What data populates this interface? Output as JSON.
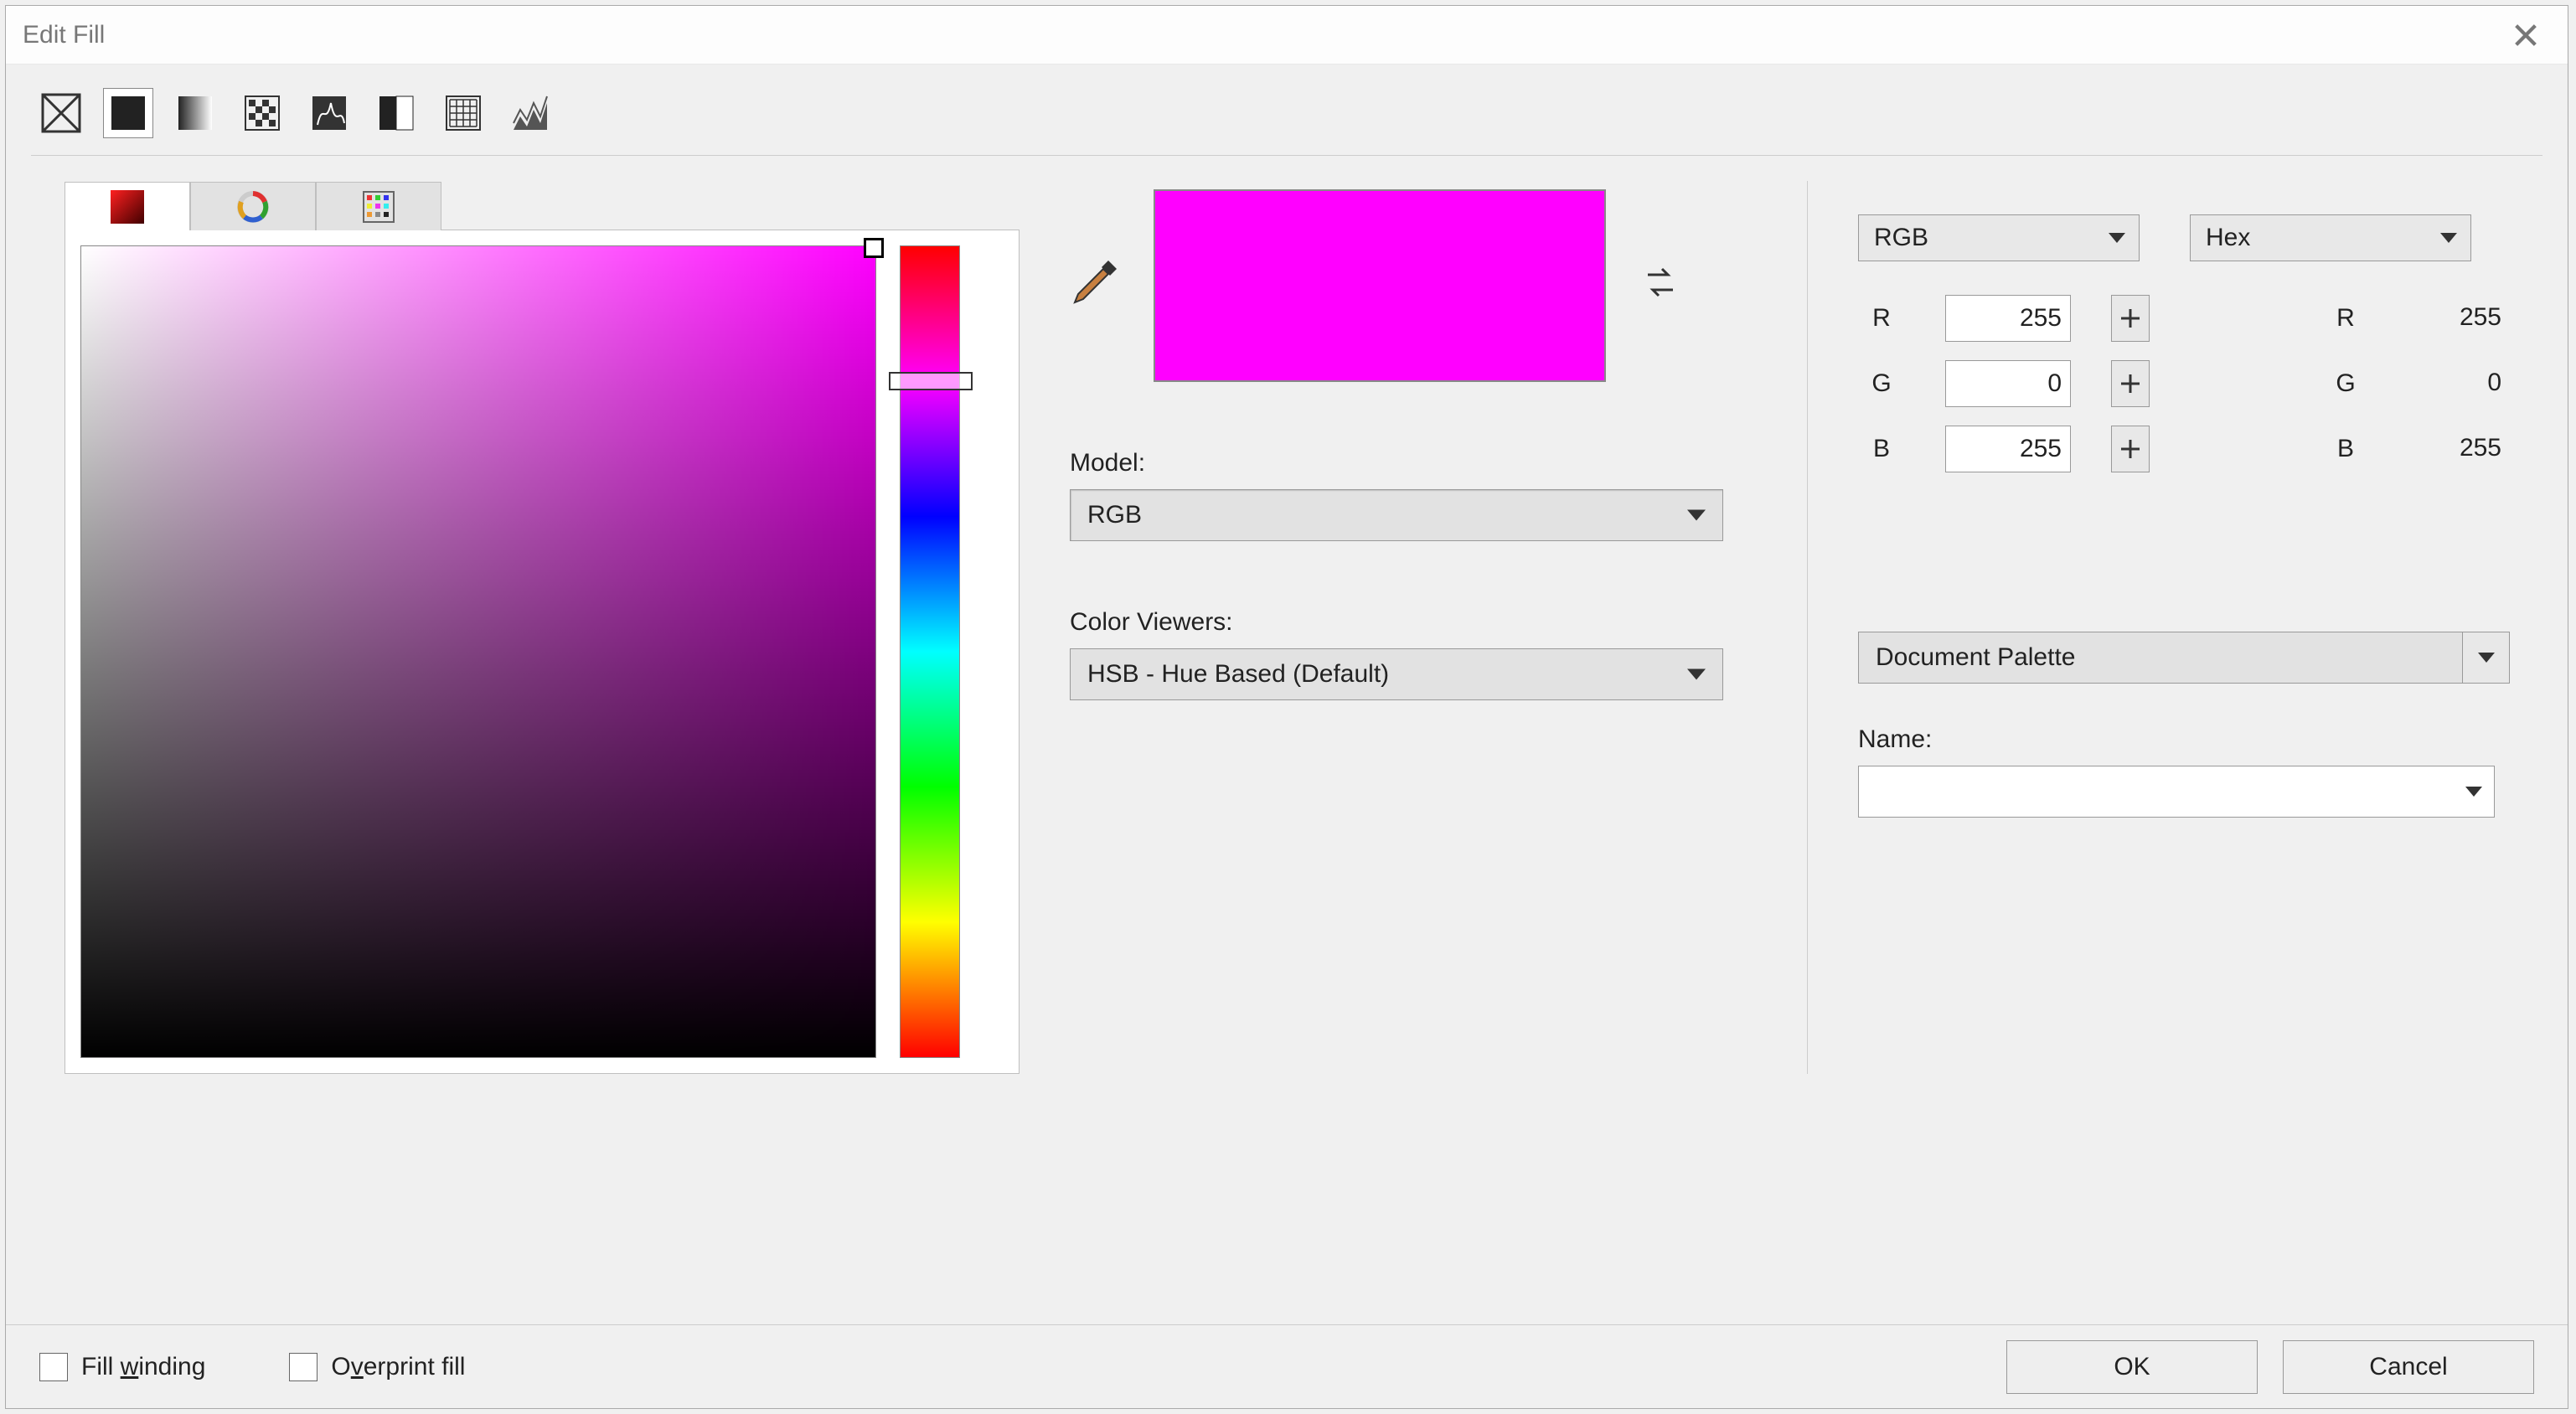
{
  "title": "Edit Fill",
  "fillTypes": [
    "none",
    "solid",
    "fountain",
    "pattern",
    "texture",
    "two-color",
    "postscript",
    "bitmap"
  ],
  "selectedFillType": "solid",
  "selectedPickerTab": "gradient-swatch",
  "currentColor": "#ff00ff",
  "hueHandlePercent": 15.5,
  "model": {
    "label": "Model:",
    "value": "RGB"
  },
  "viewers": {
    "label": "Color Viewers:",
    "value": "HSB - Hue Based (Default)"
  },
  "colorSpaces": {
    "primary": "RGB",
    "secondary": "Hex"
  },
  "channels": {
    "primary": [
      {
        "name": "R",
        "value": 255
      },
      {
        "name": "G",
        "value": 0
      },
      {
        "name": "B",
        "value": 255
      }
    ],
    "secondary": [
      {
        "name": "R",
        "value": 255
      },
      {
        "name": "G",
        "value": 0
      },
      {
        "name": "B",
        "value": 255
      }
    ]
  },
  "palette": {
    "value": "Document Palette"
  },
  "colorName": {
    "label": "Name:",
    "value": ""
  },
  "footer": {
    "fillWinding": {
      "label": "Fill winding",
      "checked": false
    },
    "overprint": {
      "label": "Overprint fill",
      "checked": false
    },
    "ok": "OK",
    "cancel": "Cancel"
  }
}
